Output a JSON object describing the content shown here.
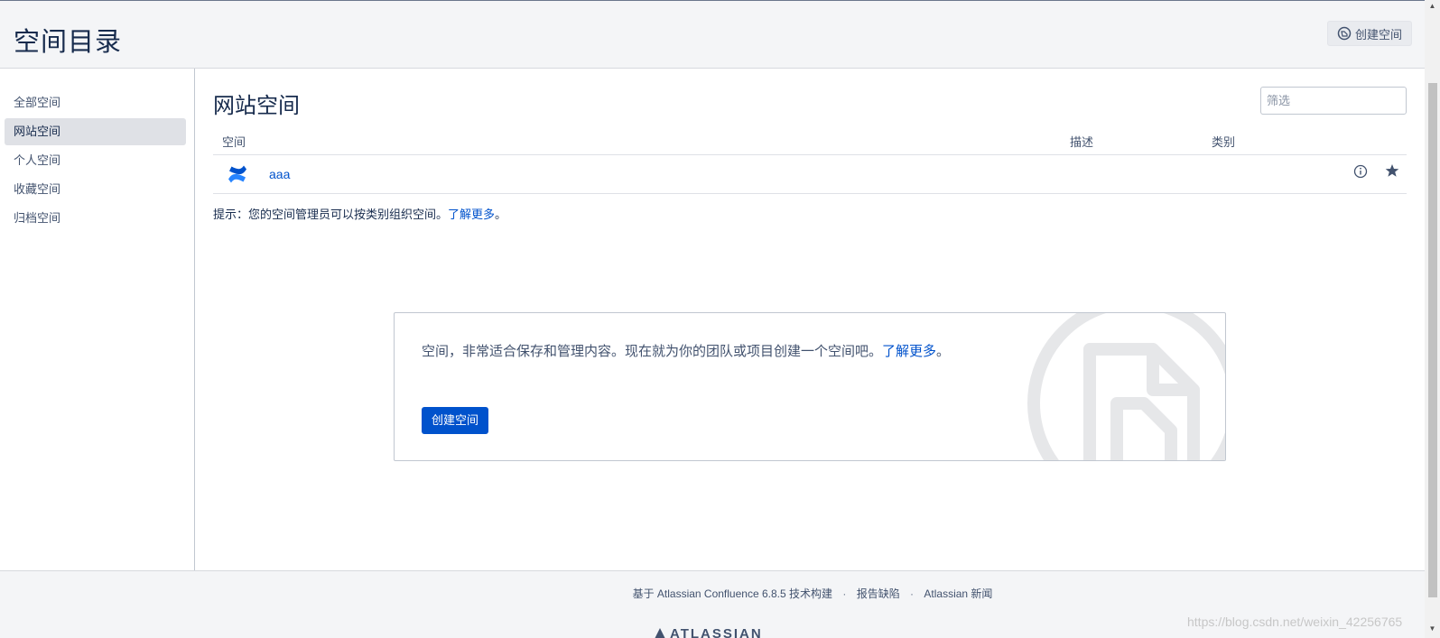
{
  "header": {
    "title": "空间目录",
    "create_space_label": "创建空间"
  },
  "sidebar": {
    "items": [
      {
        "label": "全部空间"
      },
      {
        "label": "网站空间"
      },
      {
        "label": "个人空间"
      },
      {
        "label": "收藏空间"
      },
      {
        "label": "归档空间"
      }
    ],
    "active_index": 1
  },
  "main": {
    "title": "网站空间",
    "filter_placeholder": "筛选",
    "columns": {
      "space": "空间",
      "description": "描述",
      "category": "类别"
    },
    "rows": [
      {
        "name": "aaa",
        "icon": "confluence-logo-icon"
      }
    ],
    "tip_prefix": "提示：您的空间管理员可以按类别组织空间。",
    "tip_link": "了解更多",
    "tip_suffix": "。"
  },
  "promo": {
    "text": "空间，非常适合保存和管理内容。现在就为你的团队或项目创建一个空间吧。",
    "link": "了解更多",
    "suffix": "。",
    "button_label": "创建空间"
  },
  "footer": {
    "built_with": "基于 Atlassian Confluence 6.8.5 技术构建",
    "report_bug": "报告缺陷",
    "news": "Atlassian 新闻",
    "separator": "·",
    "logo_text": "ATLASSIAN"
  },
  "watermark": "https://blog.csdn.net/weixin_42256765",
  "colors": {
    "accent": "#0052cc",
    "header_bg": "#f4f5f7",
    "text": "#172b4d"
  }
}
